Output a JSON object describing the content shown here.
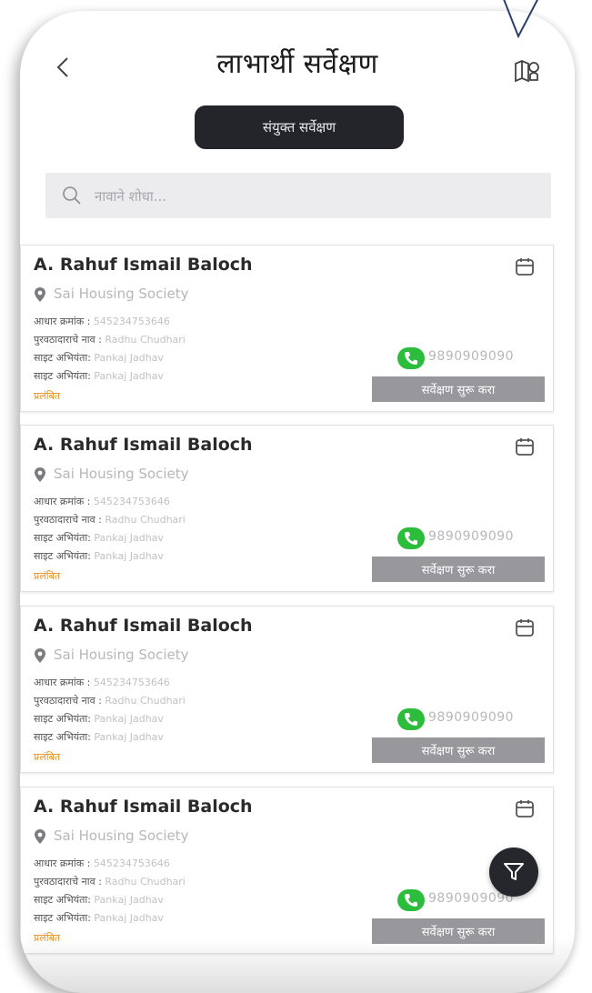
{
  "header": {
    "title": "लाभार्थी सर्वेक्षण",
    "joint_survey_label": "संयुक्त सर्वेक्षण"
  },
  "search": {
    "placeholder": "नावाने शोधा..."
  },
  "cards": [
    {
      "name": "A. Rahuf Ismail Baloch",
      "location": "Sai Housing Society",
      "aadhar_label": "आधार क्रमांक :",
      "aadhar_value": "545234753646",
      "supplier_label": "पुरवठादाराचे नाव :",
      "supplier_value": "Radhu Chudhari",
      "officer1_label": "साइट अभियंता:",
      "officer1_value": "Pankaj Jadhav",
      "officer2_label": "साइट अभियंता:",
      "officer2_value": "Pankaj Jadhav",
      "status": "प्रलंबित",
      "phone": "9890909090",
      "button_label": "सर्वेक्षण सुरू करा"
    },
    {
      "name": "A. Rahuf Ismail Baloch",
      "location": "Sai Housing Society",
      "aadhar_label": "आधार क्रमांक :",
      "aadhar_value": "545234753646",
      "supplier_label": "पुरवठादाराचे नाव :",
      "supplier_value": "Radhu Chudhari",
      "officer1_label": "साइट अभियंता:",
      "officer1_value": "Pankaj Jadhav",
      "officer2_label": "साइट अभियंता:",
      "officer2_value": "Pankaj Jadhav",
      "status": "प्रलंबित",
      "phone": "9890909090",
      "button_label": "सर्वेक्षण सुरू करा"
    },
    {
      "name": "A. Rahuf Ismail Baloch",
      "location": "Sai Housing Society",
      "aadhar_label": "आधार क्रमांक :",
      "aadhar_value": "545234753646",
      "supplier_label": "पुरवठादाराचे नाव :",
      "supplier_value": "Radhu Chudhari",
      "officer1_label": "साइट अभियंता:",
      "officer1_value": "Pankaj Jadhav",
      "officer2_label": "साइट अभियंता:",
      "officer2_value": "Pankaj Jadhav",
      "status": "प्रलंबित",
      "phone": "9890909090",
      "button_label": "सर्वेक्षण सुरू करा"
    },
    {
      "name": "A. Rahuf Ismail Baloch",
      "location": "Sai Housing Society",
      "aadhar_label": "आधार क्रमांक :",
      "aadhar_value": "545234753646",
      "supplier_label": "पुरवठादाराचे नाव :",
      "supplier_value": "Radhu Chudhari",
      "officer1_label": "साइट अभियंता:",
      "officer1_value": "Pankaj Jadhav",
      "officer2_label": "साइट अभियंता:",
      "officer2_value": "Pankaj Jadhav",
      "status": "प्रलंबित",
      "phone": "9890909090",
      "button_label": "सर्वेक्षण सुरू करा"
    }
  ],
  "icons": {
    "back": "chevron-left-icon",
    "map": "map-pin-icon",
    "search": "search-icon",
    "card": "calendar-icon",
    "location": "location-pin-icon",
    "phone": "phone-icon",
    "filter": "filter-icon"
  },
  "colors": {
    "phone_badge": "#2dbd3c",
    "status_pending": "#e6901e",
    "dark_button": "#23252b"
  }
}
